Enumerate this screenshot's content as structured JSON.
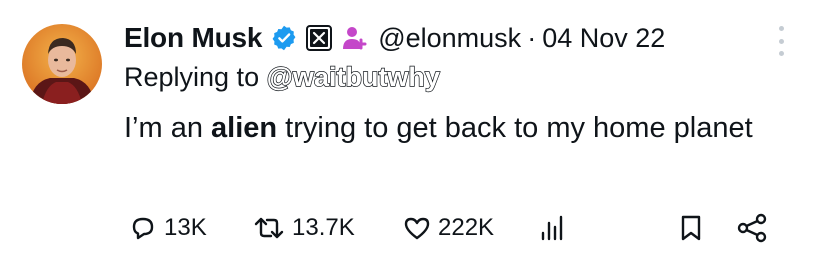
{
  "tweet": {
    "author_name": "Elon Musk",
    "handle": "@elonmusk",
    "separator": "·",
    "date": "04 Nov 22",
    "reply_prefix": "Replying to",
    "reply_to": "@waitbutwhy",
    "text_before": "I’m an ",
    "text_bold": "alien",
    "text_after": " trying to get back to my home planet"
  },
  "badges": {
    "verified_icon": "verified-badge-icon",
    "affiliate_icon": "x-logo-icon",
    "extra_icon": "person-add-icon",
    "verified_color": "#1d9bf0",
    "extra_color": "#c447c9"
  },
  "actions": {
    "replies": "13K",
    "reposts": "13.7K",
    "likes": "222K"
  },
  "colors": {
    "text": "#0f1419",
    "muted": "#536471"
  }
}
